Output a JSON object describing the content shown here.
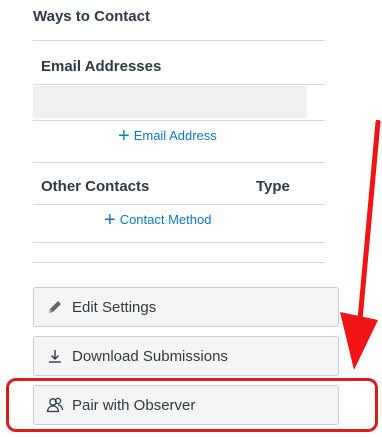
{
  "section": {
    "title": "Ways to Contact"
  },
  "email": {
    "header": "Email Addresses",
    "add_label": "Email Address"
  },
  "other": {
    "header": "Other Contacts",
    "type_header": "Type",
    "add_label": "Contact Method"
  },
  "actions": [
    {
      "label": "Edit Settings",
      "icon": "pencil-icon"
    },
    {
      "label": "Download Submissions",
      "icon": "download-icon"
    },
    {
      "label": "Pair with Observer",
      "icon": "pair-observer-icon"
    }
  ],
  "colors": {
    "link": "#0d7bc1",
    "highlight": "#e01b1b",
    "arrow": "#f01414"
  }
}
